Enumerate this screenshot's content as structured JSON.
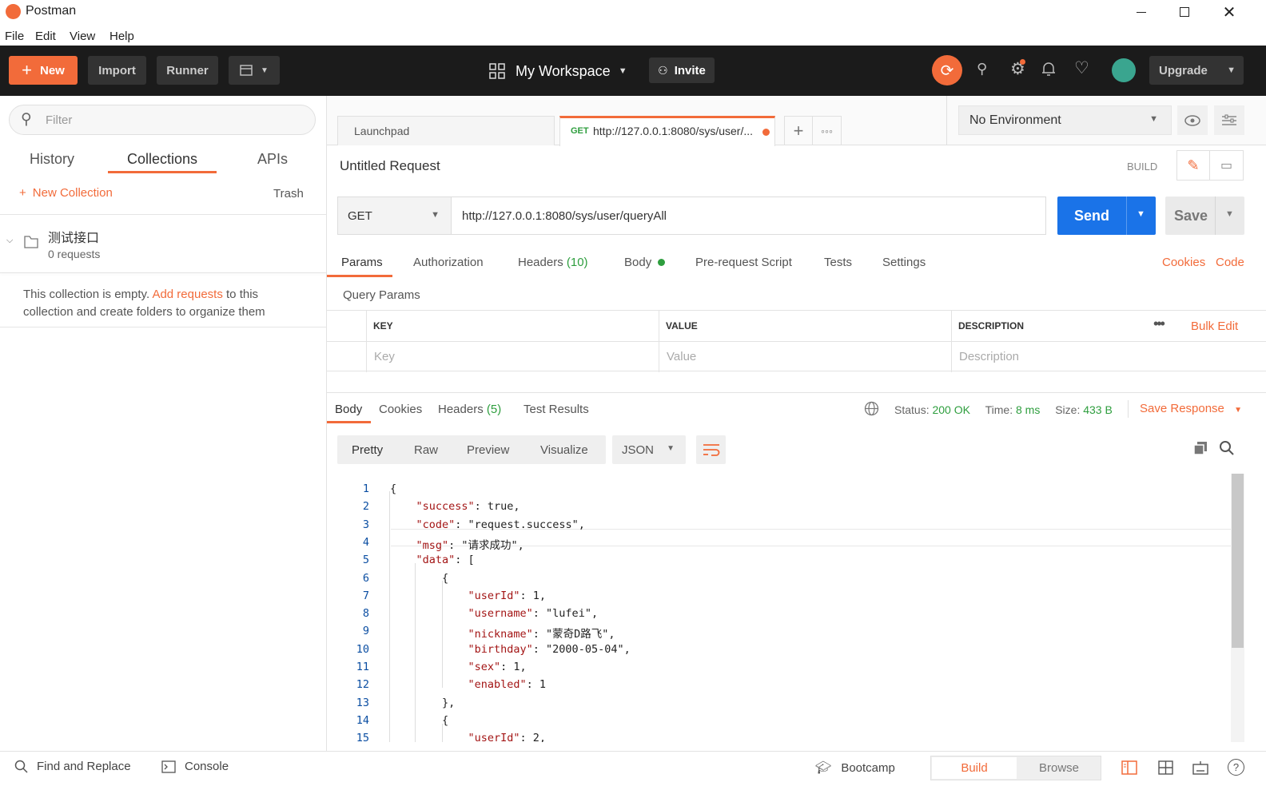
{
  "window": {
    "title": "Postman"
  },
  "menu": [
    "File",
    "Edit",
    "View",
    "Help"
  ],
  "header": {
    "new_label": "New",
    "import_label": "Import",
    "runner_label": "Runner",
    "workspace_label": "My Workspace",
    "invite_label": "Invite",
    "upgrade_label": "Upgrade"
  },
  "sidebar": {
    "filter_placeholder": "Filter",
    "tabs": [
      "History",
      "Collections",
      "APIs"
    ],
    "new_collection_label": "New Collection",
    "trash_label": "Trash",
    "collection": {
      "name": "测试接口",
      "count": "0 requests"
    },
    "empty_text_1": "This collection is empty.",
    "empty_link": "Add requests",
    "empty_text_2": "to this",
    "empty_text_3": "collection and create folders to organize them"
  },
  "tabs": {
    "launchpad": "Launchpad",
    "active_method": "GET",
    "active_url": "http://127.0.0.1:8080/sys/user/..."
  },
  "environment": {
    "selected": "No Environment"
  },
  "request": {
    "name": "Untitled Request",
    "mode": "BUILD",
    "method": "GET",
    "url": "http://127.0.0.1:8080/sys/user/queryAll",
    "send_label": "Send",
    "save_label": "Save",
    "subtabs": [
      "Params",
      "Authorization",
      "Headers",
      "Body",
      "Pre-request Script",
      "Tests",
      "Settings"
    ],
    "headers_count": "(10)",
    "cookies_link": "Cookies",
    "code_link": "Code",
    "query_params_title": "Query Params",
    "columns": [
      "KEY",
      "VALUE",
      "DESCRIPTION"
    ],
    "bulk_edit": "Bulk Edit",
    "placeholders": [
      "Key",
      "Value",
      "Description"
    ]
  },
  "response": {
    "tabs": [
      "Body",
      "Cookies",
      "Headers",
      "Test Results"
    ],
    "headers_count": "(5)",
    "status_label": "Status:",
    "status_value": "200 OK",
    "time_label": "Time:",
    "time_value": "8 ms",
    "size_label": "Size:",
    "size_value": "433 B",
    "save_response": "Save Response",
    "view_modes": [
      "Pretty",
      "Raw",
      "Preview",
      "Visualize"
    ],
    "format": "JSON",
    "body_lines": [
      {
        "n": "1",
        "t": "{"
      },
      {
        "n": "2",
        "t": "\"success\": true,"
      },
      {
        "n": "3",
        "t": "\"code\": \"request.success\","
      },
      {
        "n": "4",
        "t": "\"msg\": \"请求成功\","
      },
      {
        "n": "5",
        "t": "\"data\": ["
      },
      {
        "n": "6",
        "t": "{"
      },
      {
        "n": "7",
        "t": "\"userId\": 1,"
      },
      {
        "n": "8",
        "t": "\"username\": \"lufei\","
      },
      {
        "n": "9",
        "t": "\"nickname\": \"蒙奇D路飞\","
      },
      {
        "n": "10",
        "t": "\"birthday\": \"2000-05-04\","
      },
      {
        "n": "11",
        "t": "\"sex\": 1,"
      },
      {
        "n": "12",
        "t": "\"enabled\": 1"
      },
      {
        "n": "13",
        "t": "},"
      },
      {
        "n": "14",
        "t": "{"
      },
      {
        "n": "15",
        "t": "\"userId\": 2,"
      }
    ]
  },
  "footer": {
    "find_replace": "Find and Replace",
    "console": "Console",
    "bootcamp": "Bootcamp",
    "build": "Build",
    "browse": "Browse"
  },
  "colors": {
    "accent": "#f26b3a",
    "send_blue": "#1a73e8",
    "success_green": "#2e9e3e",
    "header_bg": "#1b1b1b"
  }
}
